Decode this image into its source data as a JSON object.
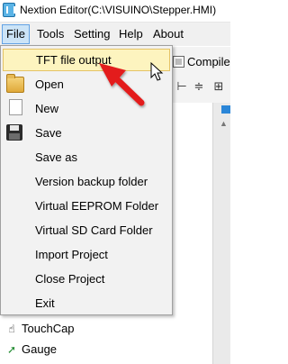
{
  "window": {
    "title": "Nextion Editor(C:\\VISUINO\\Stepper.HMI)"
  },
  "menubar": {
    "items": [
      "File",
      "Tools",
      "Setting",
      "Help",
      "About"
    ]
  },
  "toolbar": {
    "compile_label": "Compile"
  },
  "file_menu": {
    "items": [
      {
        "label": "TFT file output",
        "icon": "none",
        "highlighted": true
      },
      {
        "label": "Open",
        "icon": "folder-icon"
      },
      {
        "label": "New",
        "icon": "new-document-icon"
      },
      {
        "label": "Save",
        "icon": "floppy-disk-icon"
      },
      {
        "label": "Save as",
        "icon": "none"
      },
      {
        "label": "Version backup folder",
        "icon": "none"
      },
      {
        "label": "Virtual EEPROM Folder",
        "icon": "none"
      },
      {
        "label": "Virtual SD Card Folder",
        "icon": "none"
      },
      {
        "label": "Import Project",
        "icon": "none"
      },
      {
        "label": "Close Project",
        "icon": "none"
      },
      {
        "label": "Exit",
        "icon": "none"
      }
    ]
  },
  "toolbox": {
    "items": [
      {
        "label": "TouchCap",
        "icon": "hand-pointer-icon"
      },
      {
        "label": "Gauge",
        "icon": "gauge-arrow-icon"
      }
    ]
  },
  "colors": {
    "highlight_bg": "#fdf4bf",
    "highlight_border": "#e5c365",
    "menu_active_bg": "#cce4f7",
    "annotation_arrow": "#e31b1b"
  }
}
